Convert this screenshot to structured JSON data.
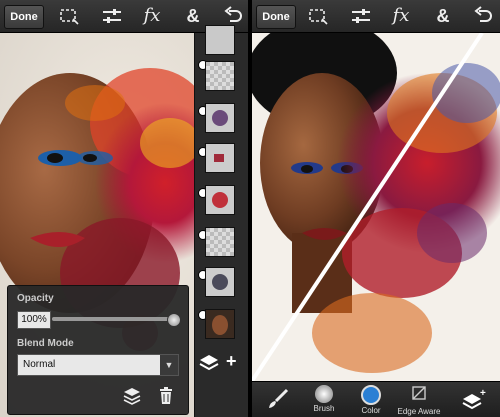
{
  "left_screen": {
    "toolbar": {
      "done_label": "Done",
      "tools": [
        "selection-icon",
        "adjust-icon",
        "fx-icon",
        "ampersand-icon",
        "undo-icon"
      ],
      "fx_label": "fx",
      "amp_label": "&"
    },
    "panel": {
      "opacity_label": "Opacity",
      "opacity_value": "100%",
      "opacity_fraction": 1.0,
      "blend_label": "Blend Mode",
      "blend_value": "Normal",
      "dropdown_icon": "chevron-down-icon"
    },
    "layers": {
      "count": 8,
      "add_icon": "+"
    }
  },
  "right_screen": {
    "toolbar": {
      "done_label": "Done",
      "fx_label": "fx",
      "amp_label": "&"
    },
    "bottom_bar": {
      "brush_label": "Brush",
      "color_label": "Color",
      "edge_label": "Edge Aware"
    }
  },
  "colors": {
    "accent_blue": "#2a7fd4",
    "toolbar_dark": "#262626"
  }
}
